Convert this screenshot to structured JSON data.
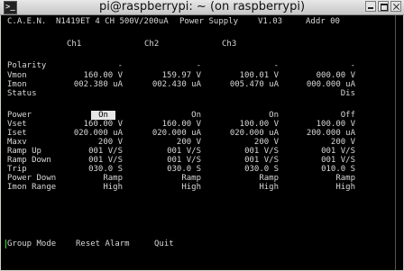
{
  "window": {
    "title": "pi@raspberrypi: ~ (on raspberrypi)"
  },
  "header": {
    "vendor": "C.A.E.N.",
    "model": "N1419ET 4 CH 500V/200uA",
    "product": "Power Supply",
    "version": "V1.03",
    "address": "Addr 00"
  },
  "channels": [
    "Ch1",
    "Ch2",
    "Ch3"
  ],
  "rows": [
    {
      "label": "Polarity",
      "values": [
        "-",
        "-",
        "-",
        "-"
      ]
    },
    {
      "label": "Vmon",
      "values": [
        "160.00 V",
        "159.97 V",
        "100.01 V",
        "000.00 V"
      ]
    },
    {
      "label": "Imon",
      "values": [
        "002.380 uA",
        "002.430 uA",
        "005.470 uA",
        "000.000 uA"
      ]
    },
    {
      "label": "Status",
      "values": [
        "",
        "",
        "",
        "Dis"
      ]
    },
    {
      "label": "Power",
      "values": [
        "On",
        "On",
        "On",
        "Off"
      ]
    },
    {
      "label": "Vset",
      "values": [
        "160.00 V",
        "160.00 V",
        "100.00 V",
        "100.00 V"
      ]
    },
    {
      "label": "Iset",
      "values": [
        "020.000 uA",
        "020.000 uA",
        "020.000 uA",
        "200.000 uA"
      ]
    },
    {
      "label": "Maxv",
      "values": [
        "200 V",
        "200 V",
        "200 V",
        "200 V"
      ]
    },
    {
      "label": "Ramp Up",
      "values": [
        "001 V/S",
        "001 V/S",
        "001 V/S",
        "001 V/S"
      ]
    },
    {
      "label": "Ramp Down",
      "values": [
        "001 V/S",
        "001 V/S",
        "001 V/S",
        "001 V/S"
      ]
    },
    {
      "label": "Trip",
      "values": [
        "030.0 S",
        "030.0 S",
        "030.0 S",
        "010.0 S"
      ]
    },
    {
      "label": "Power Down",
      "values": [
        "Ramp",
        "Ramp",
        "Ramp",
        "Ramp"
      ]
    },
    {
      "label": "Imon Range",
      "values": [
        "High",
        "High",
        "High",
        "High"
      ]
    }
  ],
  "menu": [
    "Group Mode",
    "Reset Alarm",
    "Quit"
  ],
  "colors": {
    "background": "#000000",
    "text": "#d8d8d8",
    "highlight": "#e6e6e6",
    "cursor": "#2ee02e"
  }
}
